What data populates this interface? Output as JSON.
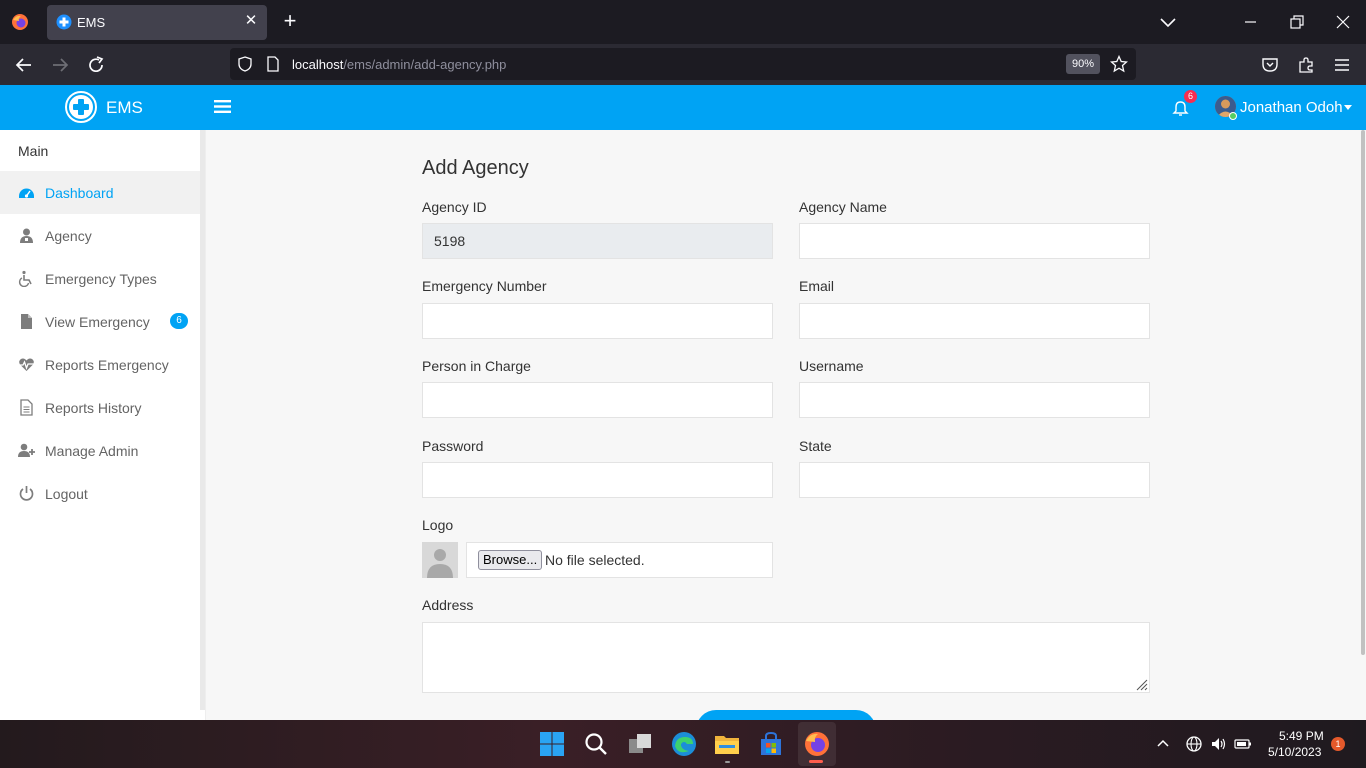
{
  "browser": {
    "tab_title": "EMS",
    "url_host": "localhost",
    "url_path": "/ems/admin/add-agency.php",
    "zoom": "90%"
  },
  "header": {
    "brand": "EMS",
    "notification_count": "6",
    "user_name": "Jonathan Odoh"
  },
  "sidebar": {
    "title": "Main",
    "items": [
      {
        "label": "Dashboard",
        "icon": "dashboard-icon",
        "active": true
      },
      {
        "label": "Agency",
        "icon": "agency-icon"
      },
      {
        "label": "Emergency Types",
        "icon": "wheelchair-icon"
      },
      {
        "label": "View Emergency",
        "icon": "file-icon",
        "badge": "6"
      },
      {
        "label": "Reports Emergency",
        "icon": "heartbeat-icon"
      },
      {
        "label": "Reports History",
        "icon": "document-icon"
      },
      {
        "label": "Manage Admin",
        "icon": "user-plus-icon"
      },
      {
        "label": "Logout",
        "icon": "power-icon"
      }
    ]
  },
  "form": {
    "title": "Add Agency",
    "agency_id_label": "Agency ID",
    "agency_id_value": "5198",
    "agency_name_label": "Agency Name",
    "emergency_number_label": "Emergency Number",
    "email_label": "Email",
    "person_in_charge_label": "Person in Charge",
    "username_label": "Username",
    "password_label": "Password",
    "state_label": "State",
    "logo_label": "Logo",
    "browse_label": "Browse...",
    "file_status": "No file selected.",
    "address_label": "Address"
  },
  "taskbar": {
    "time": "5:49 PM",
    "date": "5/10/2023",
    "notification_count": "1"
  },
  "colors": {
    "accent": "#00a3f4",
    "alert": "#f62d51"
  }
}
